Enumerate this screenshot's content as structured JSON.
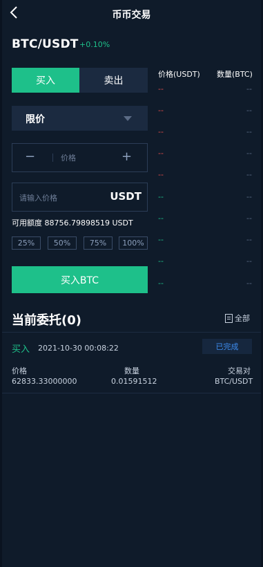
{
  "header": {
    "title": "币币交易",
    "back_icon": "chevron-left-icon"
  },
  "market": {
    "pair": "BTC/USDT",
    "change": "+0.10%"
  },
  "trade": {
    "tab_buy": "买入",
    "tab_sell": "卖出",
    "order_type": "限价",
    "price_placeholder": "价格",
    "minus": "−",
    "plus": "+",
    "amount_placeholder": "请输入价格",
    "amount_unit": "USDT",
    "available": "可用额度 88756.79898519 USDT",
    "percents": [
      "25%",
      "50%",
      "75%",
      "100%"
    ],
    "submit": "买入BTC"
  },
  "orderbook": {
    "price_header": "价格(USDT)",
    "qty_header": "数量(BTC)",
    "asks": [
      {
        "price": "--",
        "qty": "--"
      },
      {
        "price": "--",
        "qty": "--"
      },
      {
        "price": "--",
        "qty": "--"
      },
      {
        "price": "--",
        "qty": "--"
      },
      {
        "price": "--",
        "qty": "--"
      }
    ],
    "bids": [
      {
        "price": "--",
        "qty": "--"
      },
      {
        "price": "--",
        "qty": "--"
      },
      {
        "price": "--",
        "qty": "--"
      },
      {
        "price": "--",
        "qty": "--"
      },
      {
        "price": "--",
        "qty": "--"
      }
    ]
  },
  "orders": {
    "title": "当前委托(0)",
    "all_label": "全部",
    "item": {
      "type": "买入",
      "time": "2021-10-30 00:08:22",
      "status": "已完成",
      "price_label": "价格",
      "price": "62833.33000000",
      "qty_label": "数量",
      "qty": "0.01591512",
      "pair_label": "交易对",
      "pair": "BTC/USDT"
    }
  },
  "colors": {
    "background": "#0f1b2a",
    "panel": "#1b2a40",
    "accent_green": "#1ec08a",
    "ask_red": "#e04b4b",
    "status_blue": "#3d8df0"
  }
}
